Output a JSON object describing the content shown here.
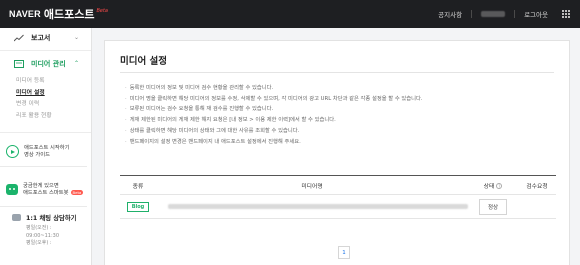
{
  "header": {
    "brand_naver": "NAVER",
    "brand_name": "애드포스트",
    "brand_badge": "Beta",
    "notice_link": "공지사항",
    "logout_button": "로그아웃"
  },
  "sidebar": {
    "menu_report": "보고서",
    "menu_media": "미디어 관리",
    "media_items": [
      "미디어 등록",
      "미디어 설정",
      "변경 이력",
      "리포 활용 현황"
    ],
    "promo_guide": [
      "애드포스트 시작하기",
      "영상 가이드"
    ],
    "promo_chatbot": [
      "궁금한게 있으면",
      "애드포스트 스마트봇"
    ],
    "chatbot_badge": "Beta",
    "chat_title": "1:1 채팅 상담하기",
    "chat_hours": [
      "평일(오전) :",
      "09:00~11:30",
      "평일(오후) :"
    ]
  },
  "main": {
    "title": "미디어 설정",
    "notes": [
      "등록한 미디어의 정보 및 미디어 검수 현황을 관리할 수 있습니다.",
      "미디어 명을 클릭하면 해당 미디어의 정보를 수정, 삭제할 수 있으며, 각 미디어의 광고 URL 차단과 같은 각종 설정을 할 수 있습니다.",
      "보류된 미디어는 검수 요청을 통해 재 검수를 진행할 수 있습니다.",
      "게재 제한된 미디어의 게재 제한 해지 요청은 [내 정보 > 이용 제한 이력]에서 할 수 있습니다.",
      "상태를 클릭하면 해당 미디어의 상태와 그에 대한 사유를 조회할 수 있습니다.",
      "밴드페이지의 설정 변경은 밴드페이지 내 애드포스트 설정에서 진행해 주세요."
    ],
    "table": {
      "headers": {
        "type": "종류",
        "media_name": "미디어명",
        "status": "상태",
        "review": "검수요청"
      },
      "rows": [
        {
          "type": "Blog",
          "status": "정상",
          "review": ""
        }
      ]
    },
    "pagination": {
      "current": "1"
    }
  }
}
